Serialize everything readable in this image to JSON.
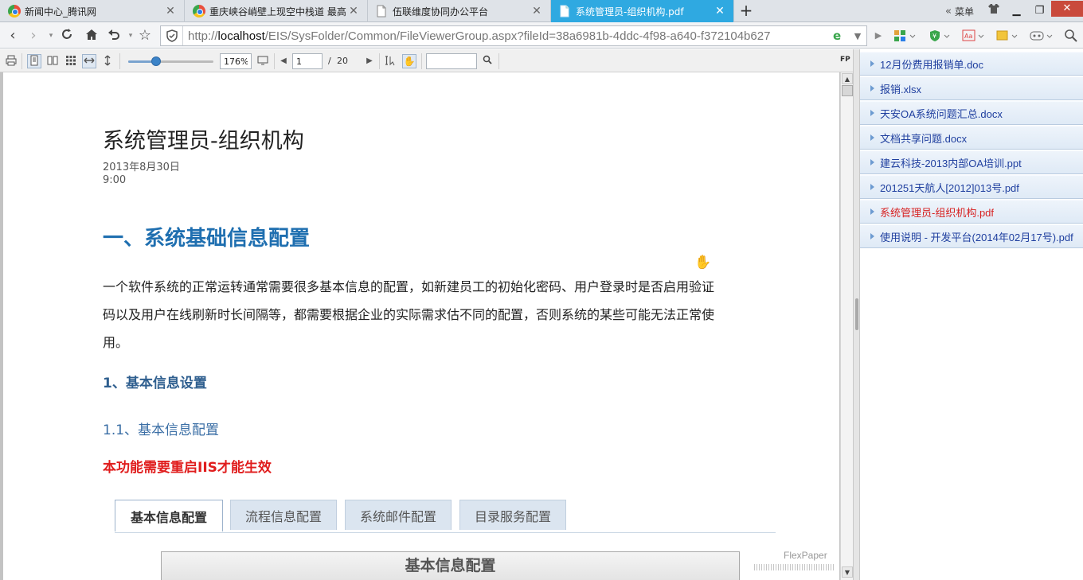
{
  "browser": {
    "tabs": [
      {
        "label": "新闻中心_腾讯网",
        "icon": "browser-ie-icon"
      },
      {
        "label": "重庆峡谷峭壁上现空中栈道 最高",
        "icon": "browser-ie-icon"
      },
      {
        "label": "伍联维度协同办公平台",
        "icon": "page-icon"
      },
      {
        "label": "系统管理员-组织机构.pdf",
        "icon": "page-icon"
      }
    ],
    "menu_label": "菜单",
    "url_host": "localhost",
    "url_prefix": "http://",
    "url_path": "/EIS/SysFolder/Common/FileViewerGroup.aspx?fileId=38a6981b-4ddc-4f98-a640-f372104b627"
  },
  "viewer": {
    "zoom": "176%",
    "zoom_fraction": 0.33,
    "page_current": "1",
    "page_separator": "/",
    "page_total": "20",
    "search_value": "",
    "fp_label": "FP",
    "brand": "FlexPaper"
  },
  "document": {
    "title": "系统管理员-组织机构",
    "date": "2013年8月30日",
    "time": "9:00",
    "heading1": "一、系统基础信息配置",
    "paragraph": "一个软件系统的正常运转通常需要很多基本信息的配置，如新建员工的初始化密码、用户登录时是否启用验证码以及用户在线刷新时长间隔等，都需要根据企业的实际需求估不同的配置，否则系统的某些可能无法正常使用。",
    "heading2": "1、基本信息设置",
    "heading3": "1.1、基本信息配置",
    "warning": "本功能需要重启IIS才能生效",
    "shot_tabs": [
      "基本信息配置",
      "流程信息配置",
      "系统邮件配置",
      "目录服务配置"
    ],
    "panel_title": "基本信息配置"
  },
  "files": [
    {
      "name": "12月份费用报销单.doc",
      "current": false
    },
    {
      "name": "报销.xlsx",
      "current": false
    },
    {
      "name": "天安OA系统问题汇总.docx",
      "current": false
    },
    {
      "name": "文档共享问题.docx",
      "current": false
    },
    {
      "name": "建云科技-2013内部OA培训.ppt",
      "current": false
    },
    {
      "name": "201251天航人[2012]013号.pdf",
      "current": false
    },
    {
      "name": "系统管理员-组织机构.pdf",
      "current": true
    },
    {
      "name": "使用说明 - 开发平台(2014年02月17号).pdf",
      "current": false
    }
  ],
  "colors": {
    "active_tab": "#2fa9e1",
    "heading_blue": "#1f6fb0",
    "warning_red": "#e01d1d",
    "file_link": "#1f3f9f",
    "current_file": "#d72222"
  }
}
